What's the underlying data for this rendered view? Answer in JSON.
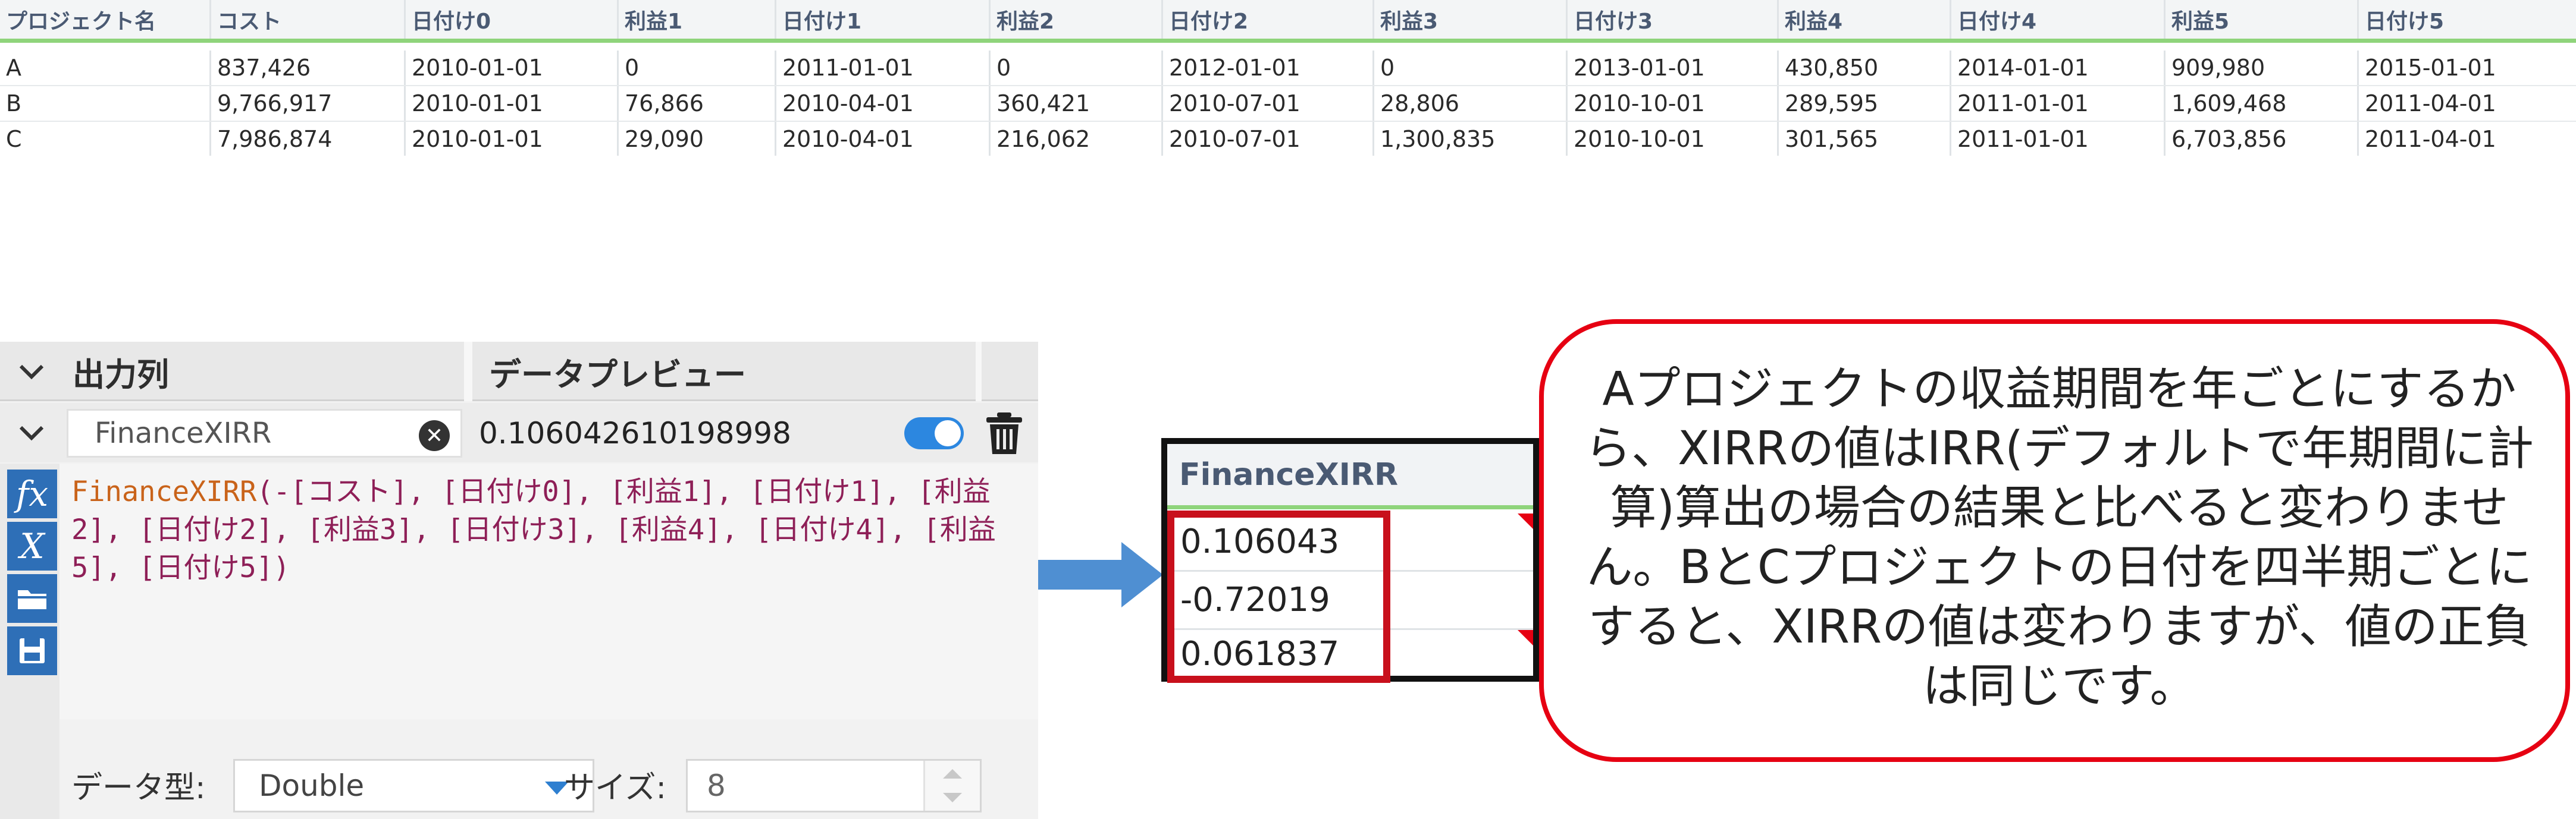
{
  "table": {
    "columns": [
      "プロジェクト名",
      "コスト",
      "日付け0",
      "利益1",
      "日付け1",
      "利益2",
      "日付け2",
      "利益3",
      "日付け3",
      "利益4",
      "日付け4",
      "利益5",
      "日付け5"
    ],
    "rows": [
      [
        "A",
        "837,426",
        "2010-01-01",
        "0",
        "2011-01-01",
        "0",
        "2012-01-01",
        "0",
        "2013-01-01",
        "430,850",
        "2014-01-01",
        "909,980",
        "2015-01-01"
      ],
      [
        "B",
        "9,766,917",
        "2010-01-01",
        "76,866",
        "2010-04-01",
        "360,421",
        "2010-07-01",
        "28,806",
        "2010-10-01",
        "289,595",
        "2011-01-01",
        "1,609,468",
        "2011-04-01"
      ],
      [
        "C",
        "7,986,874",
        "2010-01-01",
        "29,090",
        "2010-04-01",
        "216,062",
        "2010-07-01",
        "1,300,835",
        "2010-10-01",
        "301,565",
        "2011-01-01",
        "6,703,856",
        "2011-04-01"
      ]
    ]
  },
  "formula_panel": {
    "output_column_header": "出力列",
    "data_preview_header": "データプレビュー",
    "field_name": "FinanceXIRR",
    "preview_value": "0.106042610198998",
    "toggle_on": true,
    "expression_function": "FinanceXIRR",
    "expression_args": "(-[コスト], [日付け0], [利益1], [日付け1], [利益2], [日付け2], [利益3], [日付け3], [利益4], [日付け4], [利益5], [日付け5])",
    "sidebar_buttons": [
      {
        "icon": "function-icon",
        "glyph": "fx"
      },
      {
        "icon": "variable-icon",
        "glyph": "X"
      },
      {
        "icon": "folder-icon",
        "glyph": "📂"
      },
      {
        "icon": "save-icon",
        "glyph": "💾"
      }
    ],
    "data_type_label": "データ型:",
    "data_type_value": "Double",
    "size_label": "サイズ:",
    "size_value": "8"
  },
  "results_preview": {
    "header": "FinanceXIRR",
    "values": [
      "0.106043",
      "-0.72019",
      "0.061837"
    ]
  },
  "note": {
    "text": "Aプロジェクトの収益期間を年ごとにするから、XIRRの値はIRR(デフォルトで年期間に計算)算出の場合の結果と比べると変わりません。BとCプロジェクトの日付を四半期ごとにすると、XIRRの値は変わりますが、値の正負は同じです。"
  },
  "colors": {
    "accent_green": "#8fd47b",
    "header_text": "#4a5a73",
    "highlight_red": "#c8101c",
    "note_border": "#e60012",
    "arrow_blue": "#4f8fd2",
    "toggle_blue": "#2c87e0"
  }
}
